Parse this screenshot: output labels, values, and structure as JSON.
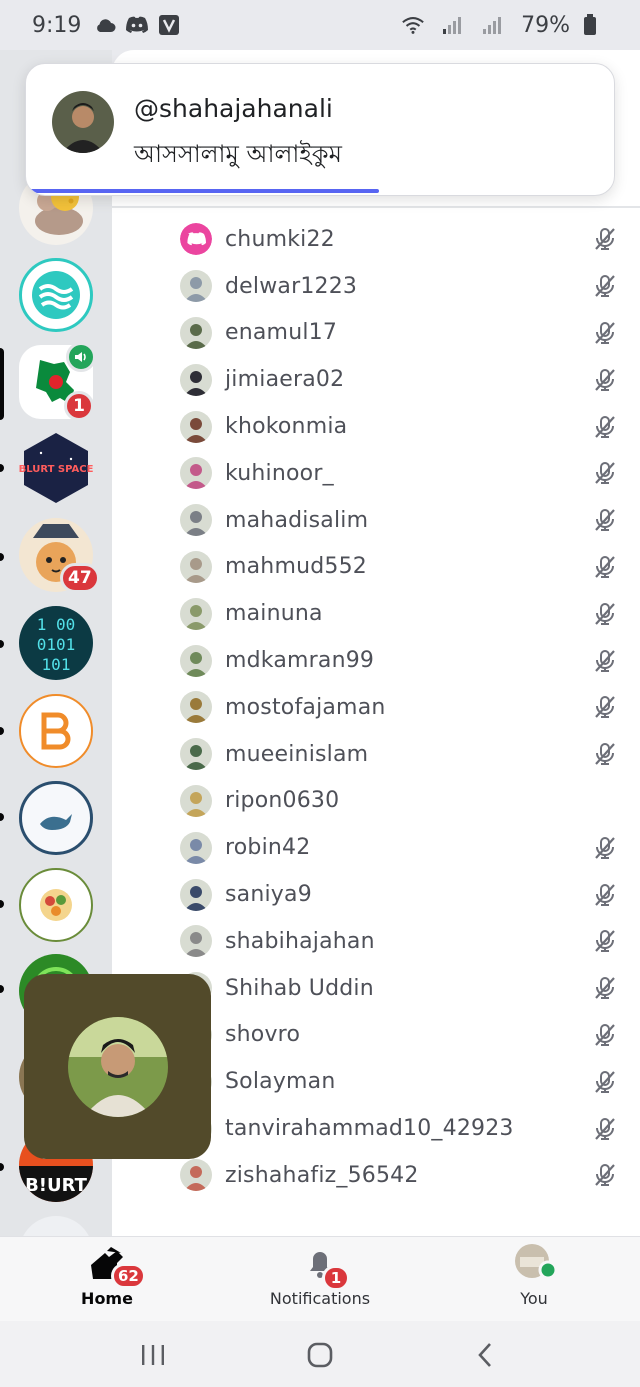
{
  "status_bar": {
    "time": "9:19",
    "battery_percent": "79%",
    "icons": [
      "cloud-icon",
      "discord-icon",
      "v-app-icon",
      "wifi-icon",
      "signal-icon",
      "signal-icon",
      "battery-icon"
    ]
  },
  "notification": {
    "username": "@shahajahanali",
    "message": "আসসালামু আলাইকুম",
    "progress": 0.6
  },
  "servers": [
    {
      "name": "mouse-cheese-server",
      "badge": null
    },
    {
      "name": "waves-server",
      "badge": null
    },
    {
      "name": "bangladesh-map-server",
      "badge": "1",
      "active": true,
      "voice": true
    },
    {
      "name": "blurt-space-server",
      "badge": null
    },
    {
      "name": "cat-wizard-server",
      "badge": "47"
    },
    {
      "name": "binary-server",
      "badge": null
    },
    {
      "name": "b-logo-server",
      "badge": null
    },
    {
      "name": "hind-whale-server",
      "badge": null
    },
    {
      "name": "nature-agriculture-server",
      "badge": null
    },
    {
      "name": "green-server",
      "badge": null
    },
    {
      "name": "brown-server",
      "badge": null
    },
    {
      "name": "blurt-server",
      "label": "B!URT",
      "badge": null
    }
  ],
  "members": [
    {
      "name": "chumki22",
      "muted": true
    },
    {
      "name": "delwar1223",
      "muted": true
    },
    {
      "name": "enamul17",
      "muted": true
    },
    {
      "name": "jimiaera02",
      "muted": true
    },
    {
      "name": "khokonmia",
      "muted": true
    },
    {
      "name": "kuhinoor_",
      "muted": true
    },
    {
      "name": "mahadisalim",
      "muted": true
    },
    {
      "name": "mahmud552",
      "muted": true
    },
    {
      "name": "mainuna",
      "muted": true
    },
    {
      "name": "mdkamran99",
      "muted": true
    },
    {
      "name": "mostofajaman",
      "muted": true
    },
    {
      "name": "mueeinislam",
      "muted": true
    },
    {
      "name": "ripon0630",
      "muted": false
    },
    {
      "name": "robin42",
      "muted": true
    },
    {
      "name": "saniya9",
      "muted": true
    },
    {
      "name": "shabihajahan",
      "muted": true
    },
    {
      "name": "Shihab Uddin",
      "muted": true
    },
    {
      "name": "shovro",
      "muted": true
    },
    {
      "name": "Solayman",
      "muted": true
    },
    {
      "name": "tanvirahammad10_42923",
      "muted": true
    },
    {
      "name": "zishahafiz_56542",
      "muted": true
    }
  ],
  "bottom_nav": {
    "home_label": "Home",
    "home_badge": "62",
    "notifications_label": "Notifications",
    "notifications_badge": "1",
    "you_label": "You"
  },
  "colors": {
    "accent": "#5865f2",
    "badge": "#da373c",
    "online": "#23a55a",
    "call_bubble": "#524a2a"
  }
}
